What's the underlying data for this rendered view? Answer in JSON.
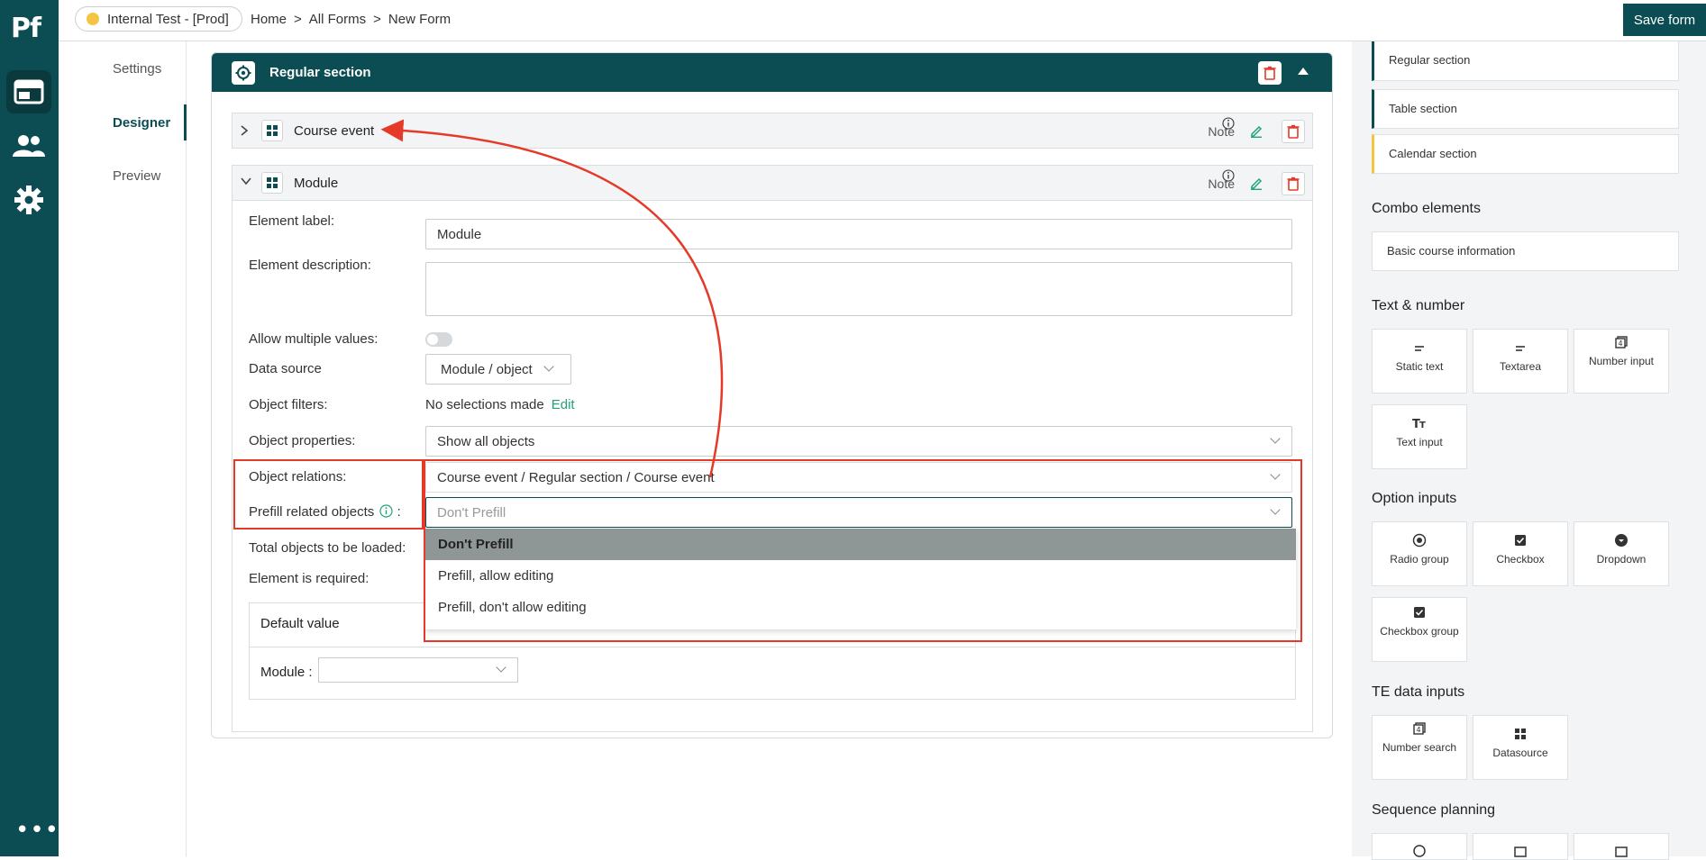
{
  "app": {
    "logo": "Pf",
    "more": "•••"
  },
  "topbar": {
    "environment": "Internal Test - [Prod]",
    "breadcrumb": [
      "Home",
      ">",
      "All Forms",
      ">",
      "New Form"
    ],
    "save_label": "Save form"
  },
  "subnav": {
    "items": [
      "Settings",
      "Designer",
      "Preview"
    ]
  },
  "section": {
    "title": "Regular section",
    "elements": [
      {
        "label": "Course event",
        "note": "Note"
      },
      {
        "label": "Module",
        "note": "Note"
      }
    ]
  },
  "module": {
    "element_label": {
      "label": "Element label:",
      "value": "Module"
    },
    "element_description": {
      "label": "Element description:"
    },
    "allow_multiple": {
      "label": "Allow multiple values:"
    },
    "data_source": {
      "label": "Data source",
      "value": "Module / object"
    },
    "object_filters": {
      "label": "Object filters:",
      "value": "No selections made",
      "edit": "Edit"
    },
    "object_properties": {
      "label": "Object properties:",
      "value": "Show all objects"
    },
    "object_relations": {
      "label": "Object relations:",
      "value": "Course event / Regular section / Course event"
    },
    "prefill": {
      "label": "Prefill related objects",
      "colon": ":",
      "placeholder": "Don't Prefill"
    },
    "prefill_options": [
      "Don't Prefill",
      "Prefill, allow editing",
      "Prefill, don't allow editing"
    ],
    "total_objects": {
      "label": "Total objects to be loaded:"
    },
    "required": {
      "label": "Element is required:"
    },
    "default_value": {
      "title": "Default value",
      "module_label": "Module :"
    }
  },
  "palette": {
    "sections": [
      "Regular section",
      "Table section",
      "Calendar section"
    ],
    "combo_head": "Combo elements",
    "combo_items": [
      "Basic course information"
    ],
    "text_head": "Text & number",
    "text_items": [
      "Static text",
      "Textarea",
      "Number input",
      "Text input"
    ],
    "option_head": "Option inputs",
    "option_items": [
      "Radio group",
      "Checkbox",
      "Dropdown",
      "Checkbox group"
    ],
    "te_head": "TE data inputs",
    "te_items": [
      "Number search",
      "Datasource"
    ],
    "seq_head": "Sequence planning"
  },
  "colors": {
    "brand": "#0b4d52",
    "accent": "#1fa37a",
    "highlight": "#e53a2a",
    "env_dot": "#f5c443"
  }
}
